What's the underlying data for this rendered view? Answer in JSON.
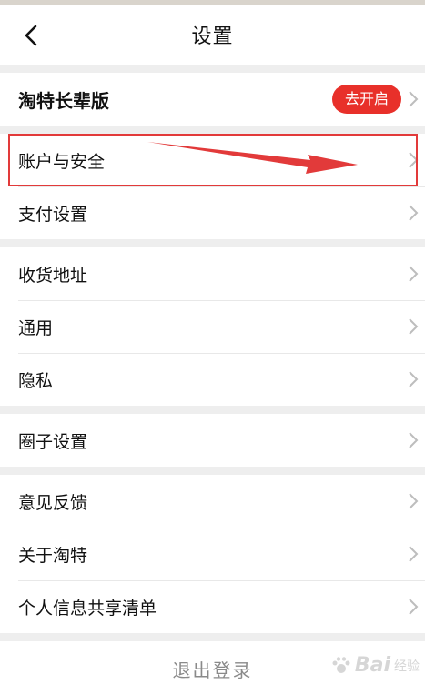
{
  "nav": {
    "title": "设置"
  },
  "groups": [
    {
      "items": [
        {
          "label": "淘特长辈版",
          "badge": "去开启"
        }
      ]
    },
    {
      "items": [
        {
          "label": "账户与安全"
        },
        {
          "label": "支付设置"
        }
      ]
    },
    {
      "items": [
        {
          "label": "收货地址"
        },
        {
          "label": "通用"
        },
        {
          "label": "隐私"
        }
      ]
    },
    {
      "items": [
        {
          "label": "圈子设置"
        }
      ]
    },
    {
      "items": [
        {
          "label": "意见反馈"
        },
        {
          "label": "关于淘特"
        },
        {
          "label": "个人信息共享清单"
        }
      ]
    }
  ],
  "logout": {
    "label": "退出登录"
  },
  "watermark": {
    "text": "Bai",
    "sub": "经验"
  },
  "colors": {
    "accent": "#e8302a",
    "annotation": "#e23a3a"
  },
  "icons": {
    "back": "chevron-left-icon",
    "row": "chevron-right-icon"
  }
}
